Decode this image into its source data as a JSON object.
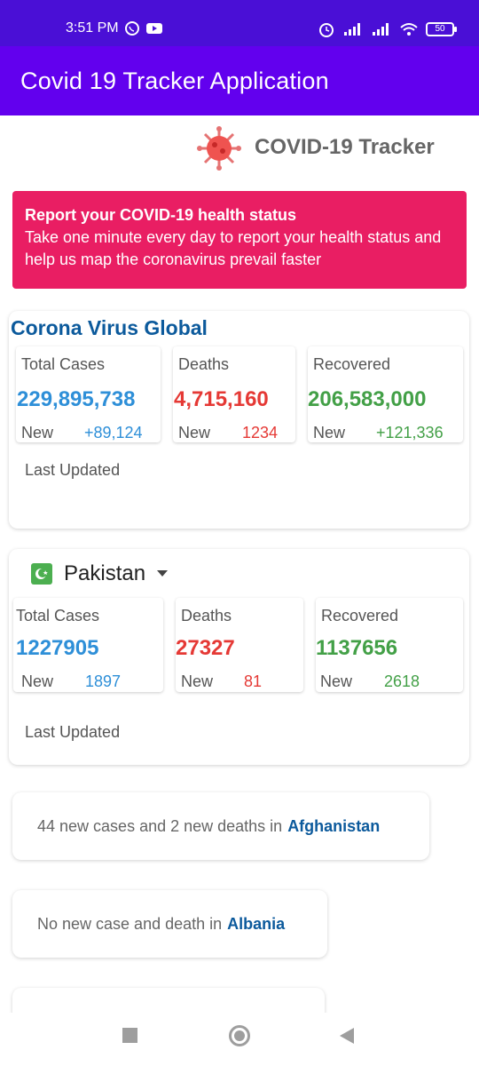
{
  "status_bar": {
    "time": "3:51 PM",
    "battery": "50",
    "left_icons": [
      "whatsapp-icon",
      "youtube-icon"
    ],
    "right_icons": [
      "alarm-icon",
      "signal-icon",
      "signal-icon",
      "wifi-icon",
      "battery-icon"
    ]
  },
  "app_bar": {
    "title": "Covid 19 Tracker Application"
  },
  "brand": {
    "title": "COVID-19 Tracker",
    "icon": "virus-icon"
  },
  "report": {
    "title": "Report your COVID-19 health status",
    "text": "Take one minute every day to report your health status and help us map the coronavirus prevail faster"
  },
  "global": {
    "title": "Corona Virus Global",
    "total_cases": {
      "label": "Total Cases",
      "value": "229,895,738",
      "new_label": "New",
      "new_value": "+89,124"
    },
    "deaths": {
      "label": "Deaths",
      "value": "4,715,160",
      "new_label": "New",
      "new_value": "1234"
    },
    "recovered": {
      "label": "Recovered",
      "value": "206,583,000",
      "new_label": "New",
      "new_value": "+121,336"
    },
    "last_updated": "Last Updated"
  },
  "country": {
    "name": "Pakistan",
    "total_cases": {
      "label": "Total Cases",
      "value": "1227905",
      "new_label": "New",
      "new_value": "1897"
    },
    "deaths": {
      "label": "Deaths",
      "value": "27327",
      "new_label": "New",
      "new_value": "81"
    },
    "recovered": {
      "label": "Recovered",
      "value": "1137656",
      "new_label": "New",
      "new_value": "2618"
    },
    "last_updated": "Last Updated"
  },
  "news": [
    {
      "text": "44 new cases and 2 new deaths in",
      "country": "Afghanistan"
    },
    {
      "text": "No new case and death in",
      "country": "Albania"
    }
  ],
  "colors": {
    "status_bar": "#4a0fd6",
    "app_bar": "#6200ee",
    "report_card": "#e91e63",
    "cases": "#2e8fd8",
    "deaths": "#e53935",
    "recovered": "#43a047",
    "link": "#0c5a9c"
  }
}
